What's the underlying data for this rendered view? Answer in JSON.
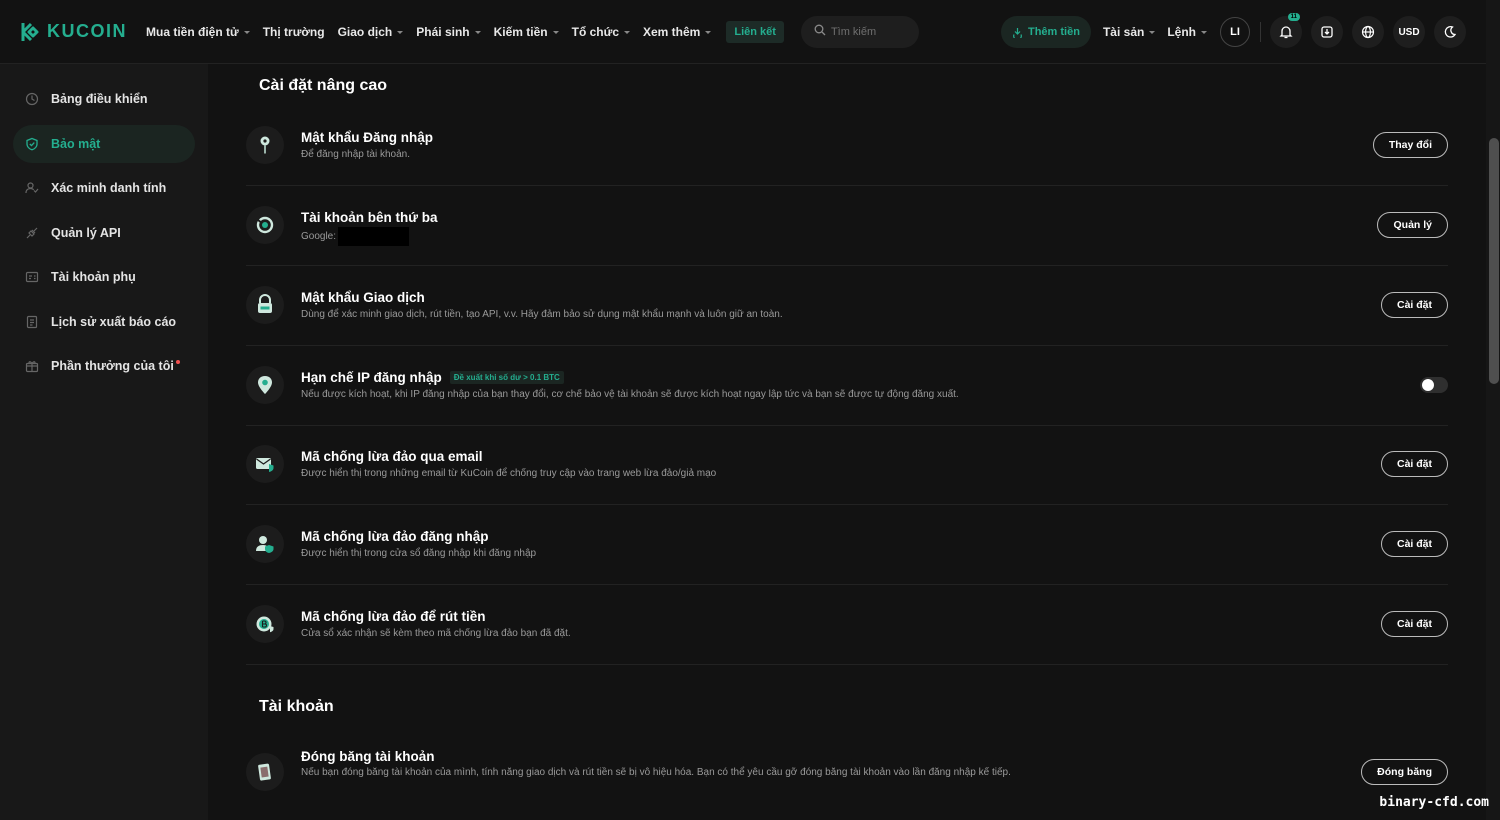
{
  "brand": {
    "name": "KUCOIN",
    "accent": "#24ae8f"
  },
  "nav": {
    "items": [
      {
        "label": "Mua tiền điện tử",
        "dropdown": true
      },
      {
        "label": "Thị trường",
        "dropdown": false
      },
      {
        "label": "Giao dịch",
        "dropdown": true
      },
      {
        "label": "Phái sinh",
        "dropdown": true
      },
      {
        "label": "Kiếm tiền",
        "dropdown": true
      },
      {
        "label": "Tổ chức",
        "dropdown": true
      },
      {
        "label": "Xem thêm",
        "dropdown": true
      }
    ],
    "affiliate": "Liên kết",
    "search_placeholder": "Tìm kiếm",
    "deposit": "Thêm tiền",
    "assets": "Tài sản",
    "orders": "Lệnh",
    "avatar": "LI",
    "notif_count": "11",
    "currency": "USD"
  },
  "sidebar": {
    "items": [
      {
        "label": "Bảng điều khiển",
        "icon": "dashboard-icon"
      },
      {
        "label": "Bảo mật",
        "icon": "shield-icon",
        "active": true
      },
      {
        "label": "Xác minh danh tính",
        "icon": "user-verify-icon"
      },
      {
        "label": "Quản lý API",
        "icon": "api-icon"
      },
      {
        "label": "Tài khoản phụ",
        "icon": "sub-account-icon"
      },
      {
        "label": "Lịch sử xuất báo cáo",
        "icon": "report-icon"
      },
      {
        "label": "Phần thưởng của tôi",
        "icon": "gift-icon",
        "dot": true
      }
    ]
  },
  "advanced": {
    "title": "Cài đặt nâng cao",
    "rows": [
      {
        "title": "Mật khẩu Đăng nhập",
        "desc": "Để đăng nhập tài khoản.",
        "action": "Thay đổi",
        "icon": "key-icon"
      },
      {
        "title": "Tài khoản bên thứ ba",
        "desc": "Google:",
        "action": "Quản lý",
        "icon": "link-icon"
      },
      {
        "title": "Mật khẩu Giao dịch",
        "desc": "Dùng để xác minh giao dịch, rút tiền, tạo API, v.v. Hãy đảm bảo sử dụng mật khẩu mạnh và luôn giữ an toàn.",
        "action": "Cài đặt",
        "icon": "lock-icon"
      },
      {
        "title": "Hạn chế IP đăng nhập",
        "tag": "Đề xuất khi số dư > 0.1 BTC",
        "desc": "Nếu được kích hoạt, khi IP đăng nhập của bạn thay đổi, cơ chế bảo vệ tài khoản sẽ được kích hoạt ngay lập tức và bạn sẽ được tự động đăng xuất.",
        "toggle": false,
        "icon": "location-icon"
      },
      {
        "title": "Mã chống lừa đảo qua email",
        "desc": "Được hiển thị trong những email từ KuCoin để chống truy cập vào trang web lừa đảo/giả mạo",
        "action": "Cài đặt",
        "icon": "email-shield-icon"
      },
      {
        "title": "Mã chống lừa đảo đăng nhập",
        "desc": "Được hiển thị trong cửa sổ đăng nhập khi đăng nhập",
        "action": "Cài đặt",
        "icon": "user-shield-icon"
      },
      {
        "title": "Mã chống lừa đảo để rút tiền",
        "desc": "Cửa sổ xác nhận sẽ kèm theo mã chống lừa đảo bạn đã đặt.",
        "action": "Cài đặt",
        "icon": "coin-shield-icon"
      }
    ]
  },
  "account": {
    "title": "Tài khoản",
    "rows": [
      {
        "title": "Đóng băng tài khoản",
        "desc": "Nếu bạn đóng băng tài khoản của mình, tính năng giao dịch và rút tiền sẽ bị vô hiệu hóa. Bạn có thể yêu cầu gỡ đóng băng tài khoản vào lần đăng nhập kế tiếp.",
        "action": "Đóng băng",
        "icon": "freeze-icon"
      }
    ]
  },
  "watermark": "binary-cfd.com"
}
